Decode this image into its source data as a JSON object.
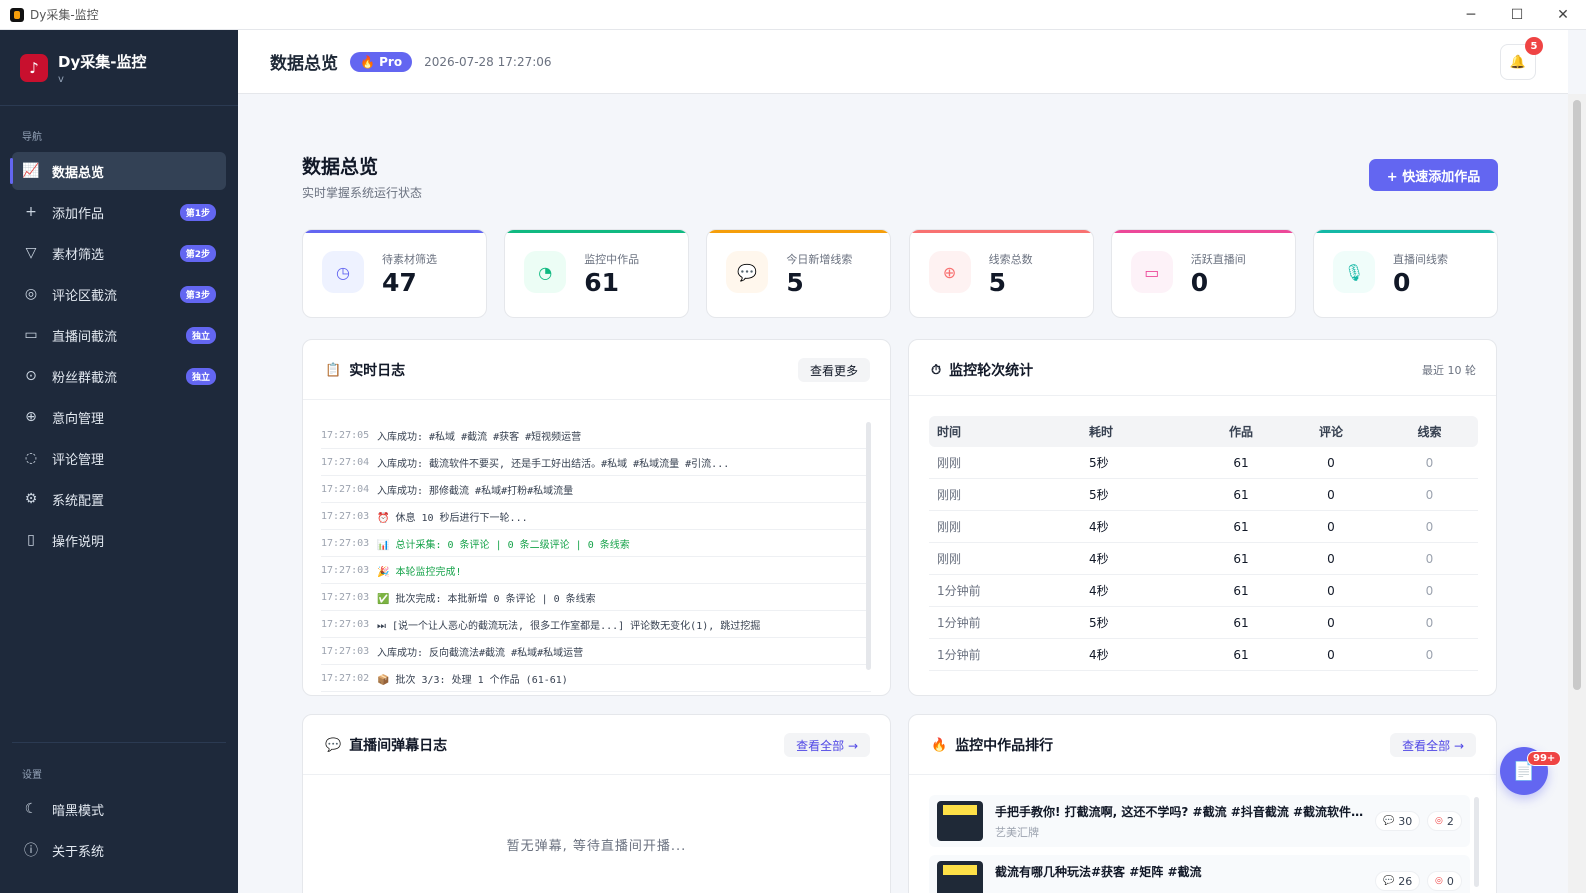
{
  "window": {
    "title": "Dy采集-监控",
    "min": "─",
    "max": "☐",
    "close": "✕"
  },
  "sidebar": {
    "brand": {
      "name": "Dy采集-监控",
      "version": "v",
      "logo": "♪"
    },
    "nav_section": "导航",
    "items": [
      {
        "label": "数据总览",
        "icon": "📈",
        "badge": ""
      },
      {
        "label": "添加作品",
        "icon": "+",
        "badge": "第1步"
      },
      {
        "label": "素材筛选",
        "icon": "▽",
        "badge": "第2步"
      },
      {
        "label": "评论区截流",
        "icon": "◎",
        "badge": "第3步"
      },
      {
        "label": "直播间截流",
        "icon": "▭",
        "badge": "独立"
      },
      {
        "label": "粉丝群截流",
        "icon": "⊙",
        "badge": "独立"
      },
      {
        "label": "意向管理",
        "icon": "⊕",
        "badge": ""
      },
      {
        "label": "评论管理",
        "icon": "◌",
        "badge": ""
      },
      {
        "label": "系统配置",
        "icon": "⚙",
        "badge": ""
      },
      {
        "label": "操作说明",
        "icon": "▯",
        "badge": ""
      }
    ],
    "settings_section": "设置",
    "settings_items": [
      {
        "label": "暗黑模式",
        "icon": "☾"
      },
      {
        "label": "关于系统",
        "icon": "ⓘ"
      }
    ]
  },
  "header": {
    "title": "数据总览",
    "pro": "🔥 Pro",
    "time": "2026-07-28 17:27:06",
    "bell_icon": "🔔",
    "bell_count": "5"
  },
  "main": {
    "title": "数据总览",
    "subtitle": "实时掌握系统运行状态",
    "quick_add": "+ 快速添加作品"
  },
  "stats": [
    {
      "label": "待素材筛选",
      "value": "47",
      "icon": "◷",
      "color": "#6366f1",
      "bg": "#eef2ff"
    },
    {
      "label": "监控中作品",
      "value": "61",
      "icon": "◔",
      "color": "#10b981",
      "bg": "#ecfdf5"
    },
    {
      "label": "今日新增线索",
      "value": "5",
      "icon": "💬",
      "color": "#f59e0b",
      "bg": "#fff7ed"
    },
    {
      "label": "线索总数",
      "value": "5",
      "icon": "⊕",
      "color": "#f87171",
      "bg": "#fef2f2"
    },
    {
      "label": "活跃直播间",
      "value": "0",
      "icon": "▭",
      "color": "#ec4899",
      "bg": "#fdf2f8"
    },
    {
      "label": "直播间线索",
      "value": "0",
      "icon": "🎙",
      "color": "#14b8a6",
      "bg": "#f0fdfa"
    }
  ],
  "log": {
    "title": "实时日志",
    "icon": "📋",
    "more": "查看更多",
    "rows": [
      {
        "time": "17:27:05",
        "msg": "入库成功: #私域 #截流 #获客 #短视频运营"
      },
      {
        "time": "17:27:04",
        "msg": "入库成功: 截流软件不要买, 还是手工好出结活。#私域 #私域流量 #引流..."
      },
      {
        "time": "17:27:04",
        "msg": "入库成功: 那修截流 #私域#打粉#私域流量"
      },
      {
        "time": "17:27:03",
        "msg": "⏰ 休息 10 秒后进行下一轮..."
      },
      {
        "time": "17:27:03",
        "msg": "📊 总计采集: 0 条评论 | 0 条二级评论 | 0 条线索"
      },
      {
        "time": "17:27:03",
        "msg": "🎉 本轮监控完成!"
      },
      {
        "time": "17:27:03",
        "msg": "✅ 批次完成: 本批新增 0 条评论 | 0 条线索"
      },
      {
        "time": "17:27:03",
        "msg": "⏭ [说一个让人恶心的截流玩法, 很多工作室都是...] 评论数无变化(1), 跳过挖掘"
      },
      {
        "time": "17:27:03",
        "msg": "入库成功: 反向截流法#截流 #私域#私域运营"
      },
      {
        "time": "17:27:02",
        "msg": "📦 批次 3/3: 处理 1 个作品 (61-61)"
      }
    ]
  },
  "rounds": {
    "title": "监控轮次统计",
    "icon": "⏱",
    "note": "最近 10 轮",
    "headers": [
      "时间",
      "耗时",
      "作品",
      "评论",
      "线索"
    ],
    "rows": [
      [
        "刚刚",
        "5秒",
        "61",
        "0",
        "0"
      ],
      [
        "刚刚",
        "5秒",
        "61",
        "0",
        "0"
      ],
      [
        "刚刚",
        "4秒",
        "61",
        "0",
        "0"
      ],
      [
        "刚刚",
        "4秒",
        "61",
        "0",
        "0"
      ],
      [
        "1分钟前",
        "4秒",
        "61",
        "0",
        "0"
      ],
      [
        "1分钟前",
        "5秒",
        "61",
        "0",
        "0"
      ],
      [
        "1分钟前",
        "4秒",
        "61",
        "0",
        "0"
      ]
    ]
  },
  "danmaku": {
    "title": "直播间弹幕日志",
    "icon": "💬",
    "view_all": "查看全部 →",
    "empty": "暂无弹幕, 等待直播间开播..."
  },
  "ranking": {
    "title": "监控中作品排行",
    "icon": "🔥",
    "view_all": "查看全部 →",
    "items": [
      {
        "title": "手把手教你! 打截流啊, 这还不学吗? #截流 #抖音截流 #截流软件 ...",
        "author": "艺美汇牌",
        "comments": "30",
        "leads": "2"
      },
      {
        "title": "截流有哪几种玩法#获客 #矩阵 #截流",
        "author": "",
        "comments": "26",
        "leads": "0"
      }
    ]
  },
  "float": {
    "icon": "📄",
    "badge": "99+"
  }
}
